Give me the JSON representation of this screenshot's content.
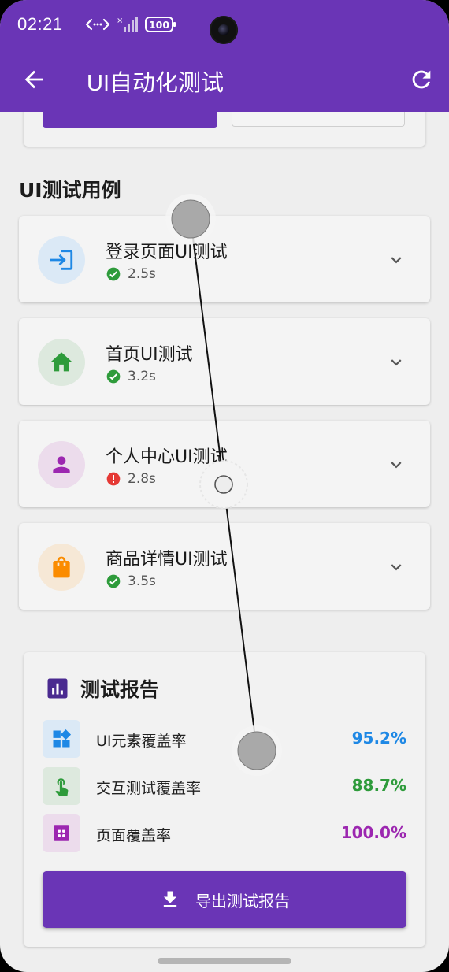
{
  "status_bar": {
    "time": "02:21",
    "battery": "100"
  },
  "app_bar": {
    "title": "UI自动化测试",
    "back_icon": "arrow-back-icon",
    "refresh_icon": "refresh-icon"
  },
  "section": {
    "title": "UI测试用例"
  },
  "cases": [
    {
      "name": "登录页面UI测试",
      "time": "2.5s",
      "status": "pass",
      "icon": "login-icon",
      "icon_color": "#1e88e5",
      "icon_bg": "#dbe9f6"
    },
    {
      "name": "首页UI测试",
      "time": "3.2s",
      "status": "pass",
      "icon": "home-icon",
      "icon_color": "#2e9b3b",
      "icon_bg": "#dde9de"
    },
    {
      "name": "个人中心UI测试",
      "time": "2.8s",
      "status": "fail",
      "icon": "person-icon",
      "icon_color": "#9c27b0",
      "icon_bg": "#ecdcec"
    },
    {
      "name": "商品详情UI测试",
      "time": "3.5s",
      "status": "pass",
      "icon": "shopping-bag-icon",
      "icon_color": "#fb8c00",
      "icon_bg": "#f6e8d6"
    }
  ],
  "report": {
    "title": "测试报告",
    "metrics": [
      {
        "label": "UI元素覆盖率",
        "value": "95.2%",
        "color": "#1e88e5",
        "icon": "widgets-icon",
        "icon_bg": "#dbe9f6"
      },
      {
        "label": "交互测试覆盖率",
        "value": "88.7%",
        "color": "#2e9b3b",
        "icon": "touch-icon",
        "icon_bg": "#dde9de"
      },
      {
        "label": "页面覆盖率",
        "value": "100.0%",
        "color": "#9c27b0",
        "icon": "page-icon",
        "icon_bg": "#ecdcec"
      }
    ],
    "export_label": "导出测试报告"
  },
  "colors": {
    "primary": "#6a35b6",
    "pass": "#2e9b3b",
    "fail": "#e53935"
  }
}
